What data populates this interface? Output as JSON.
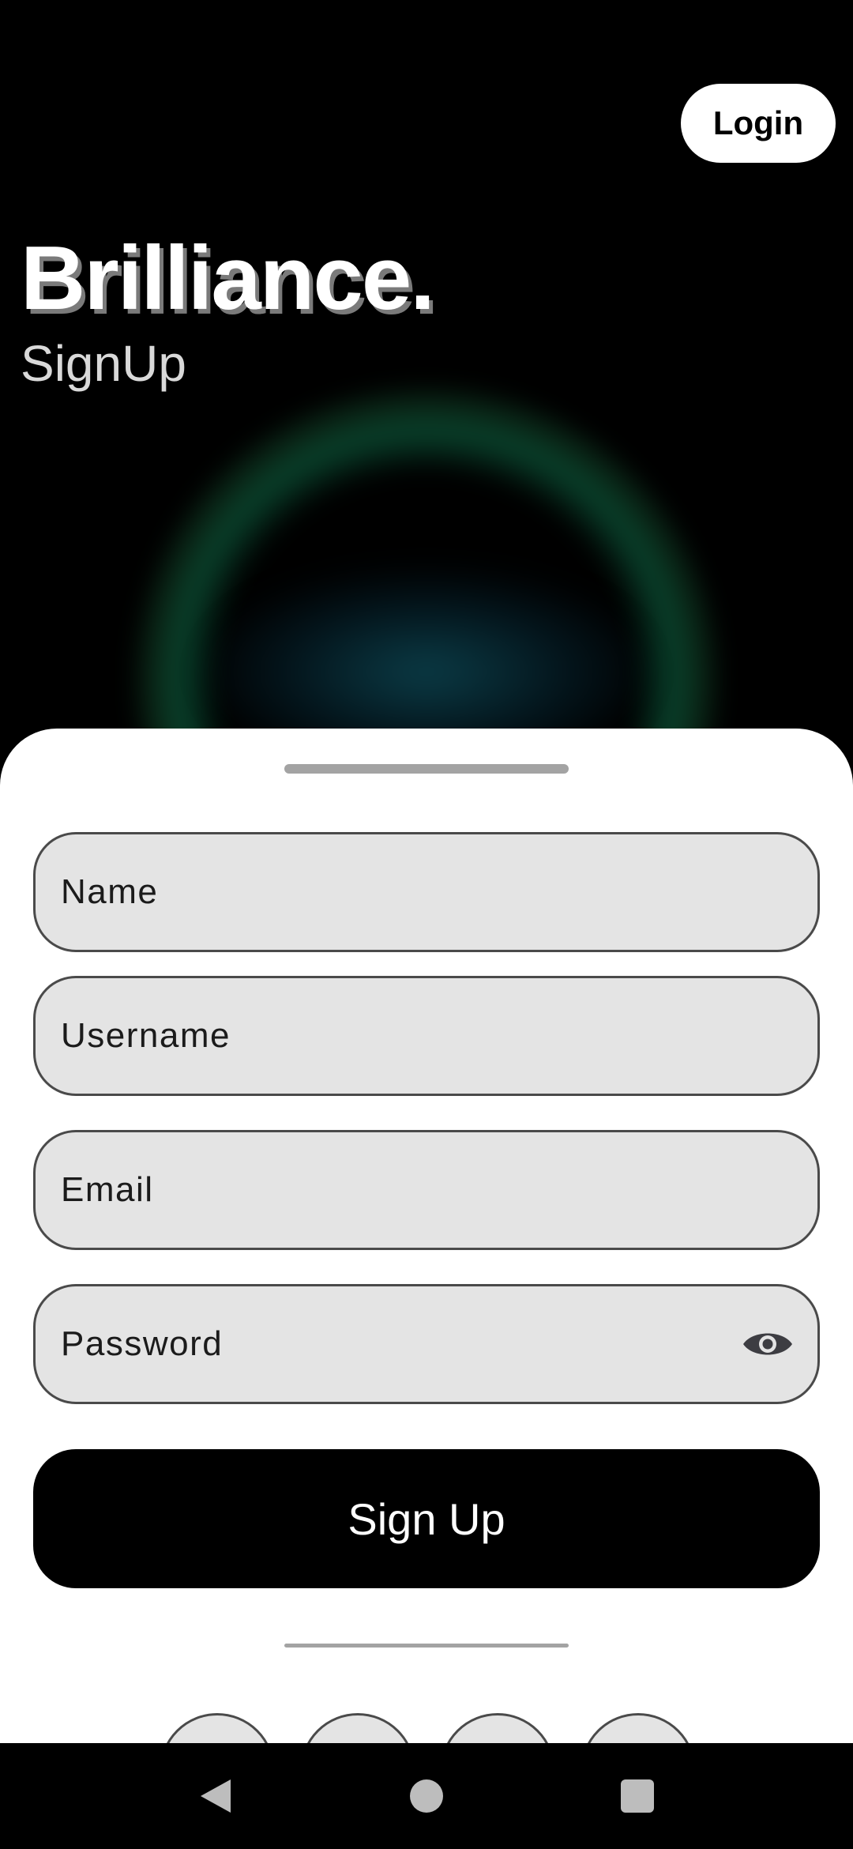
{
  "header": {
    "login_label": "Login"
  },
  "hero": {
    "brand": "Brilliance.",
    "subtitle": "SignUp"
  },
  "form": {
    "name_placeholder": "Name",
    "username_placeholder": "Username",
    "email_placeholder": "Email",
    "password_placeholder": "Password",
    "submit_label": "Sign Up"
  },
  "icons": {
    "password_toggle": "eye-icon",
    "nav_back": "triangle-back-icon",
    "nav_home": "circle-home-icon",
    "nav_recents": "square-recents-icon"
  },
  "colors": {
    "background": "#000000",
    "sheet": "#FFFFFF",
    "field": "#E4E4E4",
    "glow": "#1E9E6A"
  }
}
